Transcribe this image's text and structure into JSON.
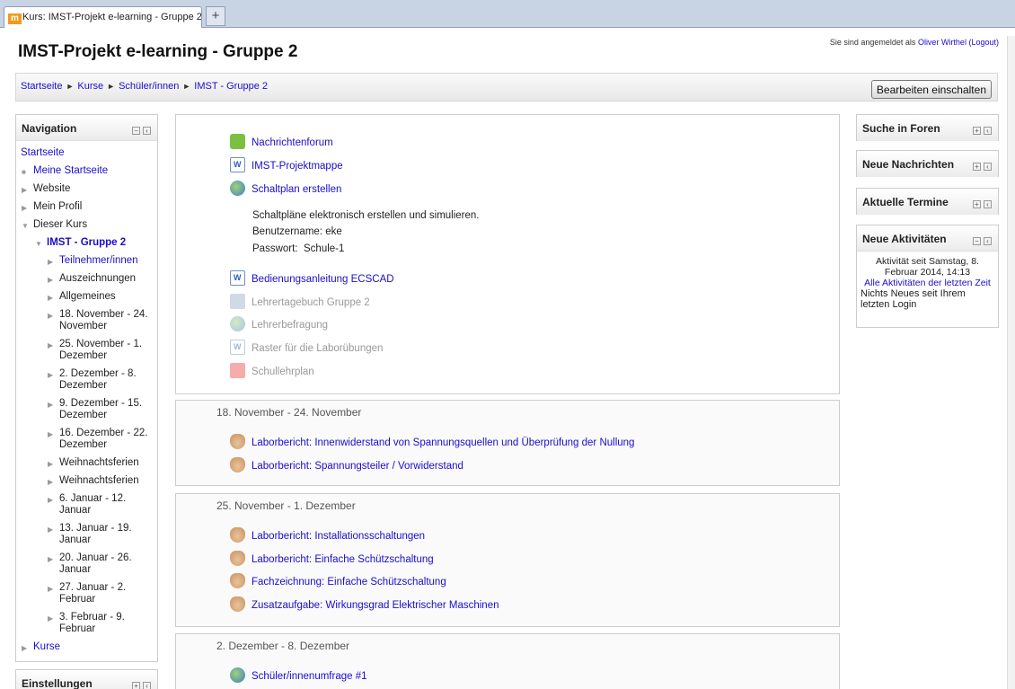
{
  "browser": {
    "tab_title": "Kurs: IMST-Projekt e-learning - Gruppe 2",
    "new_tab": "+",
    "favicon": "m"
  },
  "header": {
    "title": "IMST-Projekt e-learning - Gruppe 2",
    "login_prefix": "Sie sind angemeldet als ",
    "login_user": "Oliver Wirthel",
    "login_logout": "(Logout)"
  },
  "breadcrumb": {
    "items": [
      "Startseite",
      "Kurse",
      "Schüler/innen",
      "IMST - Gruppe 2"
    ],
    "separator": "►"
  },
  "edit_button": "Bearbeiten einschalten",
  "navigation": {
    "title": "Navigation",
    "root": "Startseite",
    "items": [
      "Meine Startseite",
      "Website",
      "Mein Profil",
      "Dieser Kurs",
      "IMST - Gruppe 2",
      "Teilnehmer/innen",
      "Auszeichnungen",
      "Allgemeines",
      "18. November - 24. November",
      "25. November - 1. Dezember",
      "2. Dezember - 8. Dezember",
      "9. Dezember - 15. Dezember",
      "16. Dezember - 22. Dezember",
      "Weihnachtsferien",
      "Weihnachtsferien",
      "6. Januar - 12. Januar",
      "13. Januar - 19. Januar",
      "20. Januar - 26. Januar",
      "27. Januar - 2. Februar",
      "3. Februar - 9. Februar",
      "Kurse"
    ]
  },
  "settings": {
    "title": "Einstellungen"
  },
  "section0": {
    "activities": [
      "Nachrichtenforum",
      "IMST-Projektmappe",
      "Schaltplan erstellen",
      "Bedienungsanleitung ECSCAD",
      "Lehrertagebuch Gruppe 2",
      "Lehrerbefragung",
      "Raster für die Laborübungen",
      "Schullehrplan"
    ],
    "description": "Schaltpläne elektronisch erstellen und simulieren.",
    "username_label": "Benutzername:",
    "username": "eke",
    "password_label": "Passwort:",
    "password": "Schule-1"
  },
  "section1": {
    "title": "18. November - 24. November",
    "activities": [
      "Laborbericht: Innenwiderstand von Spannungsquellen und Überprüfung der Nullung",
      "Laborbericht: Spannungsteiler / Vorwiderstand"
    ]
  },
  "section2": {
    "title": "25. November - 1. Dezember",
    "activities": [
      "Laborbericht: Installationsschaltungen",
      "Laborbericht: Einfache Schützschaltung",
      "Fachzeichnung: Einfache Schützschaltung",
      "Zusatzaufgabe: Wirkungsgrad Elektrischer Maschinen"
    ]
  },
  "section3": {
    "title": "2. Dezember - 8. Dezember",
    "activities": [
      "Schüler/innenumfrage #1"
    ]
  },
  "blocks": {
    "search": "Suche in Foren",
    "news": "Neue Nachrichten",
    "events": "Aktuelle Termine",
    "recent": {
      "title": "Neue Aktivitäten",
      "since": "Aktivität seit Samstag, 8. Februar 2014, 14:13",
      "all_link": "Alle Aktivitäten der letzten Zeit",
      "nothing": "Nichts Neues seit Ihrem letzten Login"
    }
  }
}
